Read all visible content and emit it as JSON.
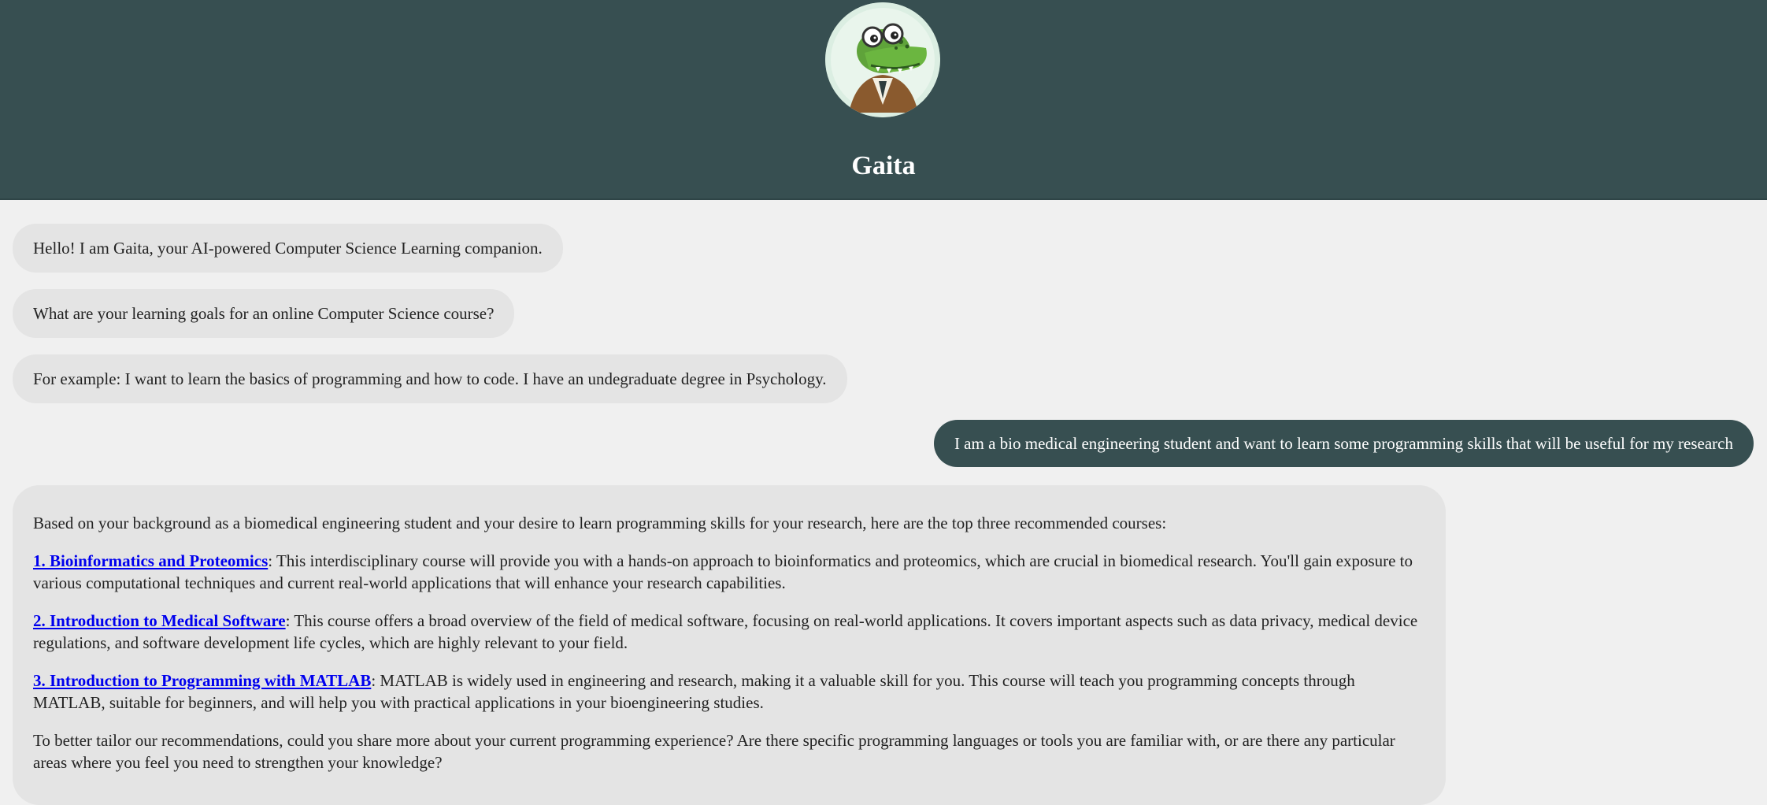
{
  "header": {
    "title": "Gaita",
    "avatar_icon": "alligator-mascot-icon"
  },
  "colors": {
    "header_bg": "#374f51",
    "page_bg": "#f0f0f0",
    "bot_bubble_bg": "#e4e4e4",
    "user_bubble_bg": "#374f51",
    "link": "#0000ee"
  },
  "messages": [
    {
      "role": "bot",
      "text": "Hello! I am Gaita, your AI-powered Computer Science Learning companion."
    },
    {
      "role": "bot",
      "text": "What are your learning goals for an online Computer Science course?"
    },
    {
      "role": "bot",
      "text": "For example: I want to learn the basics of programming and how to code. I have an undegraduate degree in Psychology."
    },
    {
      "role": "user",
      "text": "I am a bio medical engineering student and want to learn some programming skills that will be useful for my research"
    }
  ],
  "response": {
    "intro": "Based on your background as a biomedical engineering student and your desire to learn programming skills for your research, here are the top three recommended courses:",
    "courses": [
      {
        "link": "1. Bioinformatics and Proteomics",
        "text": ": This interdisciplinary course will provide you with a hands-on approach to bioinformatics and proteomics, which are crucial in biomedical research. You'll gain exposure to various computational techniques and current real-world applications that will enhance your research capabilities."
      },
      {
        "link": "2. Introduction to Medical Software",
        "text": ": This course offers a broad overview of the field of medical software, focusing on real-world applications. It covers important aspects such as data privacy, medical device regulations, and software development life cycles, which are highly relevant to your field."
      },
      {
        "link": "3. Introduction to Programming with MATLAB",
        "text": ": MATLAB is widely used in engineering and research, making it a valuable skill for you. This course will teach you programming concepts through MATLAB, suitable for beginners, and will help you with practical applications in your bioengineering studies."
      }
    ],
    "closing": "To better tailor our recommendations, could you share more about your current programming experience? Are there specific programming languages or tools you are familiar with, or are there any particular areas where you feel you need to strengthen your knowledge?"
  }
}
